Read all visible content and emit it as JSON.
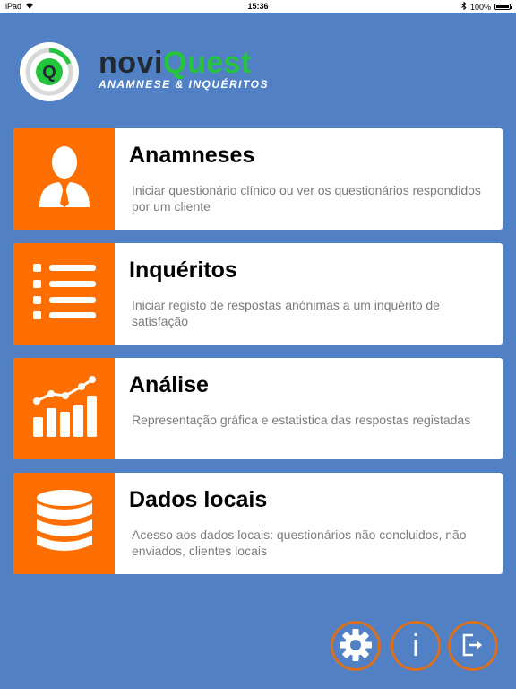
{
  "status_bar": {
    "device": "iPad",
    "time": "15:36",
    "battery": "100%"
  },
  "brand": {
    "name_part1": "novi",
    "name_part2": "Quest",
    "subtitle": "Anamnese & Inquéritos",
    "logo_letter": "Q",
    "colors": {
      "green": "#25c43d",
      "dark": "#1f2a33"
    }
  },
  "menu": {
    "items": [
      {
        "title": "Anamneses",
        "description": "Iniciar questionário clínico ou ver os questionários respondidos por um cliente",
        "icon": "person-icon"
      },
      {
        "title": "Inquéritos",
        "description": "Iniciar registo de respostas anónimas a um inquérito de satisfação",
        "icon": "list-icon"
      },
      {
        "title": "Análise",
        "description": "Representação gráfica e estatistica das respostas registadas",
        "icon": "chart-icon"
      },
      {
        "title": "Dados locais",
        "description": "Acesso aos dados locais: questionários não concluidos, não enviados, clientes locais",
        "icon": "database-icon"
      }
    ]
  },
  "actions": {
    "info_label": "i",
    "icons": [
      "gear-icon",
      "info-icon",
      "logout-icon"
    ]
  },
  "colors": {
    "background": "#5181c4",
    "accent": "#ff6e00",
    "button_ring": "#d9701f"
  }
}
